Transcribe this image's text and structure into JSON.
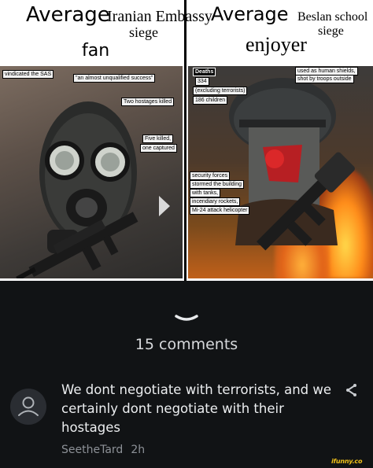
{
  "meme": {
    "left_header": {
      "title_big": "Average",
      "title_small": "Iranian Embassy",
      "title_small2": "siege",
      "subtitle": "fan"
    },
    "right_header": {
      "title_big": "Average",
      "title_small": "Beslan school",
      "title_small2": "siege",
      "subtitle": "enjoyer"
    },
    "left_labels": [
      "vindicated the SAS",
      "\"an almost unqualified success\"",
      "Two hostages killed",
      "Five killed,",
      "one captured"
    ],
    "right_labels": {
      "deaths_title": "Deaths",
      "deaths_count": "334",
      "deaths_note": "(excluding terrorists)",
      "children": "186 children",
      "shields_1": "used as human shields,",
      "shields_2": "shot by troops outside",
      "forces": [
        "security forces",
        "stormed the building",
        "with tanks,",
        "incendiary rockets,",
        "Mi-24 attack helicopter"
      ]
    }
  },
  "comments": {
    "count_label": "15 comments",
    "items": [
      {
        "text": "We dont negotiate with terrorists, and we certainly dont negotiate with their hostages",
        "username": "SeetheTard",
        "time": "2h"
      }
    ]
  },
  "watermark": "ifunny.co",
  "colors": {
    "background": "#111315",
    "text_primary": "#eceef0",
    "text_secondary": "#8d9197",
    "watermark": "#f2c21a"
  }
}
